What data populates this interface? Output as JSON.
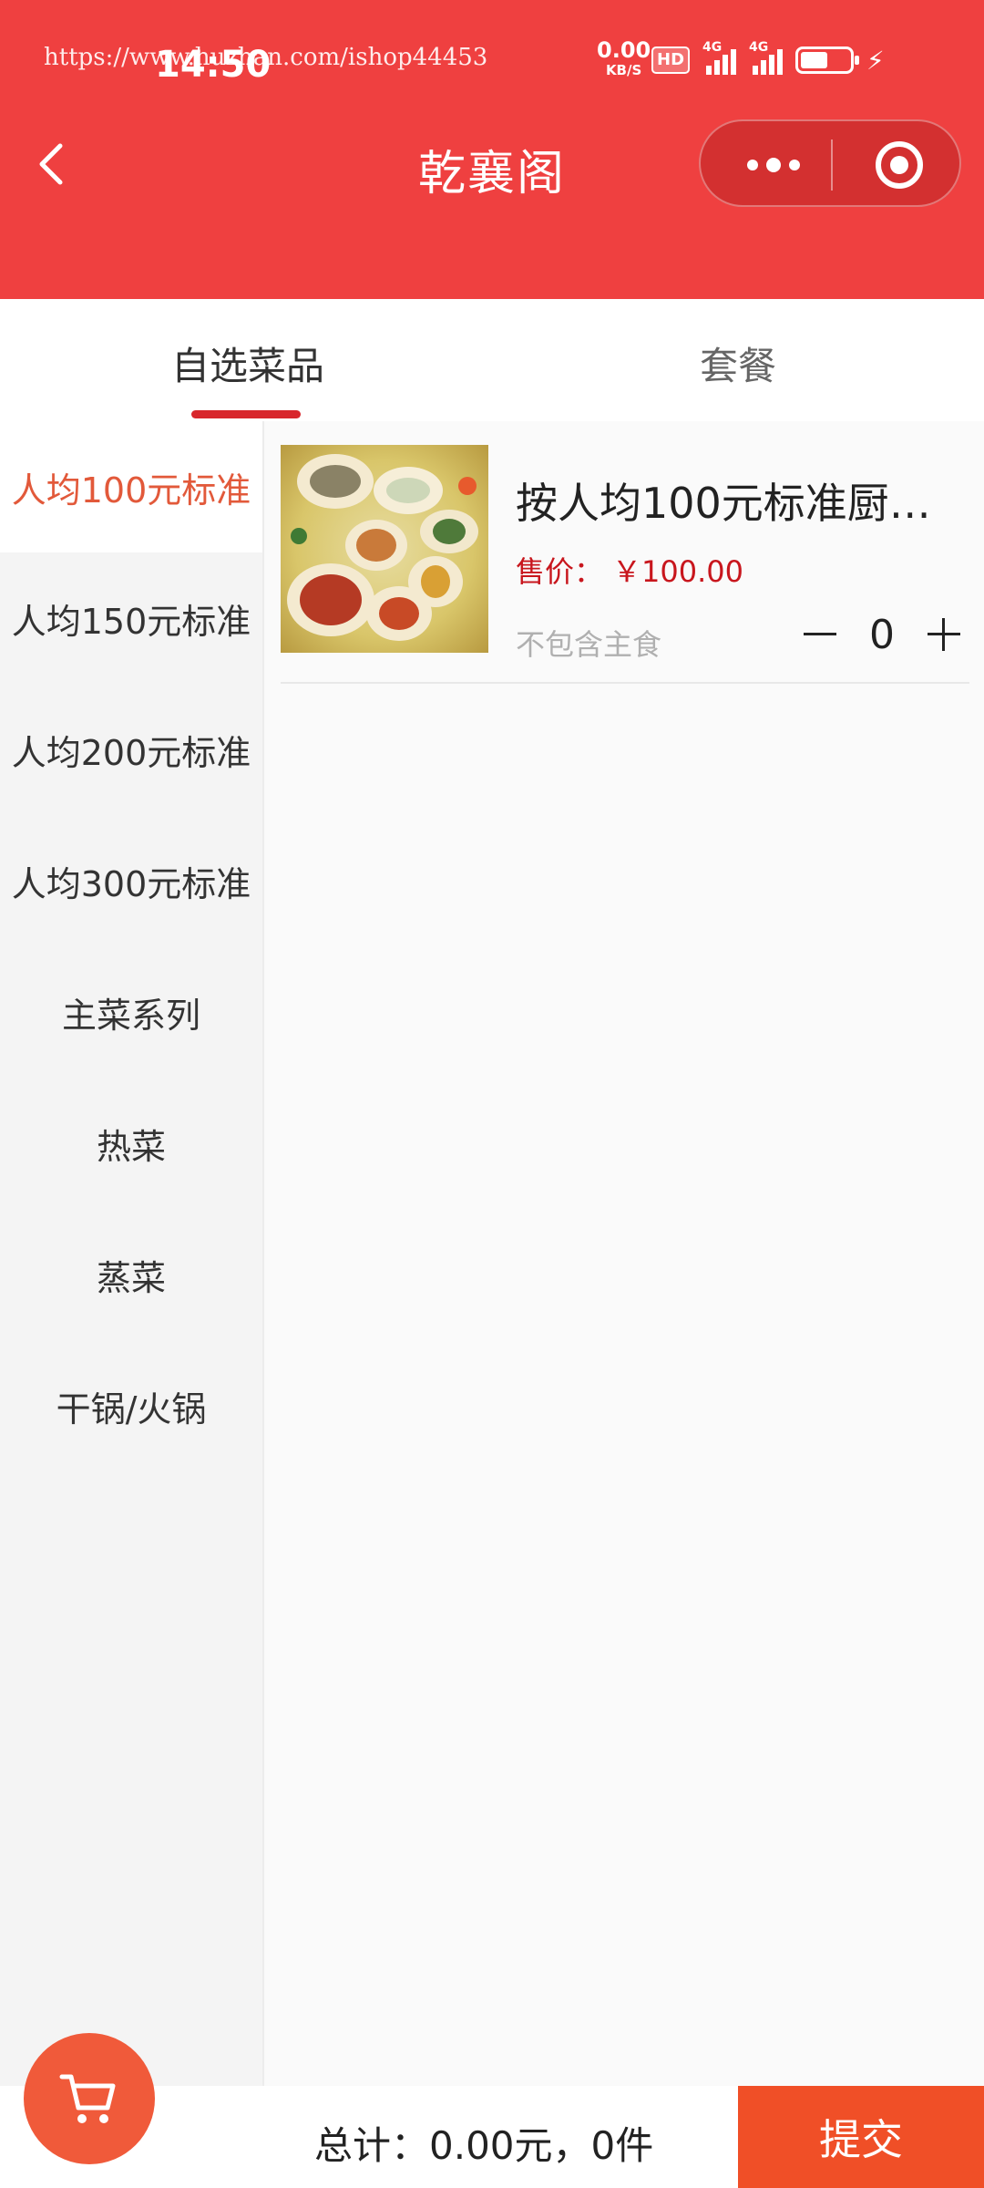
{
  "status_bar": {
    "time": "14:50",
    "watermark": "https://www.huzhan.com/ishop44453",
    "net_speed": "0.00",
    "net_unit": "KB/S",
    "hd_label": "HD",
    "signal_label": "4G"
  },
  "navbar": {
    "title": "乾襄阁"
  },
  "tabs": [
    {
      "label": "自选菜品"
    },
    {
      "label": "套餐"
    }
  ],
  "categories": [
    {
      "label": "人均100元标准"
    },
    {
      "label": "人均150元标准"
    },
    {
      "label": "人均200元标准"
    },
    {
      "label": "人均300元标准"
    },
    {
      "label": "主菜系列"
    },
    {
      "label": "热菜"
    },
    {
      "label": "蒸菜"
    },
    {
      "label": "干锅/火锅"
    }
  ],
  "products": [
    {
      "name": "按人均100元标准厨…",
      "price_label": "售价：",
      "price": "￥100.00",
      "note": "不包含主食",
      "quantity": "0"
    }
  ],
  "footer": {
    "total": "总计：0.00元，0件",
    "submit_label": "提交"
  },
  "colors": {
    "header": "#ef4040",
    "active_category": "#e2593a",
    "price": "#c8161d",
    "submit": "#f04f27",
    "cart": "#f05a3a"
  }
}
